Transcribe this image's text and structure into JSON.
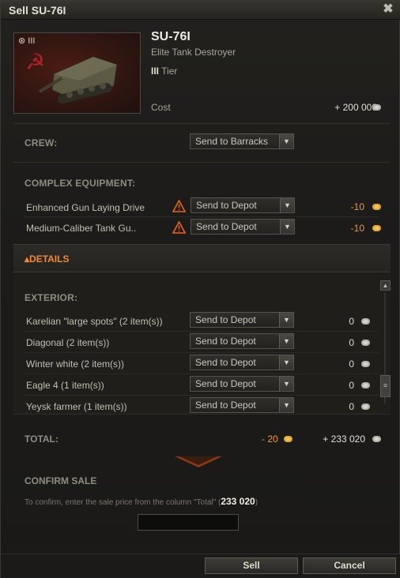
{
  "window": {
    "title": "Sell SU-76I",
    "close_label": "✖"
  },
  "vehicle": {
    "elite_badge": "III",
    "name": "SU-76I",
    "type": "Elite Tank Destroyer",
    "tier_roman": "III",
    "tier_label": "Tier",
    "cost_label": "Cost",
    "cost_value": "+ 200 000"
  },
  "crew": {
    "heading": "CREW:",
    "action": "Send to Barracks"
  },
  "complex_equipment": {
    "heading": "COMPLEX EQUIPMENT:",
    "items": [
      {
        "label": "Enhanced Gun Laying Drive",
        "action": "Send to Depot",
        "price": "-10"
      },
      {
        "label": "Medium-Caliber Tank Gu..",
        "action": "Send to Depot",
        "price": "-10"
      }
    ]
  },
  "details": {
    "label": "DETAILS"
  },
  "exterior": {
    "heading": "EXTERIOR:",
    "items": [
      {
        "label": "Karelian \"large spots\" (2 item(s))",
        "action": "Send to Depot",
        "price": "0"
      },
      {
        "label": "Diagonal (2 item(s))",
        "action": "Send to Depot",
        "price": "0"
      },
      {
        "label": "Winter white (2 item(s))",
        "action": "Send to Depot",
        "price": "0"
      },
      {
        "label": "Eagle 4 (1 item(s))",
        "action": "Send to Depot",
        "price": "0"
      },
      {
        "label": "Yeysk farmer (1 item(s))",
        "action": "Send to Depot",
        "price": "0"
      }
    ]
  },
  "total": {
    "label": "TOTAL:",
    "gold": "- 20",
    "credits": "+ 233 020"
  },
  "confirm": {
    "heading": "CONFIRM SALE",
    "instruction": "To confirm, enter the sale price from the column \"Total\" (",
    "amount": "233 020",
    "instruction_end": ")",
    "input_value": ""
  },
  "buttons": {
    "sell": "Sell",
    "cancel": "Cancel"
  },
  "colors": {
    "accent_orange": "#f08a2d",
    "gold": "#ef9a2c",
    "warning": "#e8651f"
  }
}
